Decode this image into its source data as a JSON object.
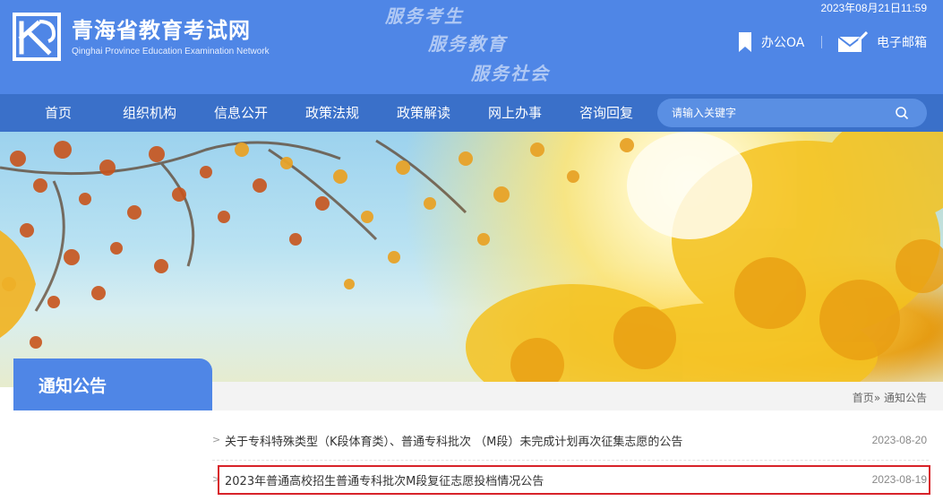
{
  "header": {
    "title": "青海省教育考试网",
    "subtitle": "Qinghai Province Education Examination Network",
    "slogans": [
      "服务考生",
      "服务教育",
      "服务社会"
    ],
    "datetime": "2023年08月21日11:59",
    "links": {
      "oa": "办公OA",
      "mail": "电子邮箱"
    },
    "brand_color": "#4f86e6"
  },
  "nav": {
    "items": [
      "首页",
      "组织机构",
      "信息公开",
      "政策法规",
      "政策解读",
      "网上办事",
      "咨询回复"
    ],
    "search_placeholder": "请输入关键字",
    "bar_color": "#3a70c9"
  },
  "section": {
    "title": "通知公告",
    "breadcrumb": {
      "home": "首页",
      "sep": "»",
      "current": "通知公告"
    }
  },
  "news": [
    {
      "title": "关于专科特殊类型（K段体育类）、普通专科批次 （M段）未完成计划再次征集志愿的公告",
      "date": "2023-08-20",
      "bullet": ">"
    },
    {
      "title": "2023年普通高校招生普通专科批次M段复征志愿投档情况公告",
      "date": "2023-08-19",
      "bullet": ">"
    }
  ],
  "highlight_color": "#d8232a",
  "icons": {
    "logo": "exam-logo-icon",
    "oa": "bookmark-icon",
    "mail": "mail-icon",
    "search": "search-icon"
  }
}
